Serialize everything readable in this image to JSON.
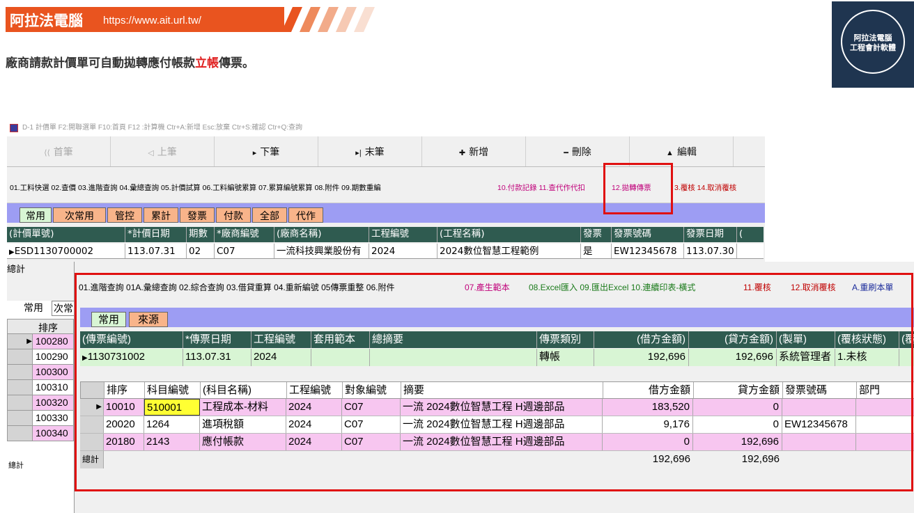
{
  "banner": {
    "brand": "阿拉法電腦",
    "url": "https://www.ait.url.tw/"
  },
  "headline": {
    "before": "廠商請款計價單可自動拋轉應付帳款",
    "highlight": "立帳",
    "after": "傳票。"
  },
  "logo": {
    "line1": "阿拉法電腦",
    "line2": "工程會計軟體"
  },
  "window1": {
    "title": "D-1 計價單   F2:開聯選單  F10:首頁   F12 :計算機  Ctr+A:新增  Esc:放棄  Ctr+S:確認  Ctr+Q:查詢",
    "toolbar": [
      {
        "icon": "⟨⟨",
        "label": "首筆",
        "dim": true
      },
      {
        "icon": "◁",
        "label": "上筆",
        "dim": true
      },
      {
        "icon": "▸",
        "label": "下筆",
        "dim": false
      },
      {
        "icon": "▸|",
        "label": "末筆",
        "dim": false
      },
      {
        "icon": "✚",
        "label": "新增",
        "dim": false
      },
      {
        "icon": "━",
        "label": "刪除",
        "dim": false
      },
      {
        "icon": "▲",
        "label": "編輯",
        "dim": false
      }
    ],
    "functions": {
      "group1": "01.工料快選 02.查價 03.進階查詢  04.彙總查詢  05.計價試算  06.工料編號累算 07.累算編號累算  08.附件  09.期數重編",
      "group2": "10.付款記錄  11.查代作代扣",
      "highlight": "12.拋轉傳票",
      "group3": "3.覆核  14.取消覆核"
    },
    "tabs": [
      "常用",
      "次常用",
      "管控",
      "累計",
      "發票",
      "付款",
      "全部",
      "代作"
    ],
    "columns": [
      "(計價單號)",
      "*計價日期",
      "期數",
      "*廠商編號",
      "(廠商名稱)",
      "工程編號",
      "(工程名稱)",
      "發票",
      "發票號碼",
      "發票日期",
      "("
    ],
    "row": [
      "ESD1130700002",
      "113.07.31",
      "02",
      "C07",
      "一流科技興業股份有",
      "2024",
      "2024數位智慧工程範例",
      "是",
      "EW12345678",
      "113.07.30",
      ""
    ],
    "total_label": "總計"
  },
  "left_panel": {
    "tabs": [
      "常用",
      "次常"
    ],
    "header": "排序",
    "rows": [
      "100280",
      "100290",
      "100300",
      "100310",
      "100320",
      "100330",
      "100340"
    ],
    "total_label": "總計"
  },
  "window2": {
    "functions": {
      "group1": "01.進階查詢 01A.彙總查詢  02.綜合查詢  03.借貸重算  04.重新編號  05傳票重整  06.附件",
      "g2": "07.產生範本",
      "g3": "08.Excel匯入  09.匯出Excel  10.連續印表-橫式",
      "g4": "11.覆核",
      "g5": "12.取消覆核",
      "g6": "A.重刷本單"
    },
    "tabs": [
      "常用",
      "來源"
    ],
    "columns": [
      "(傳票編號)",
      "*傳票日期",
      "工程編號",
      "套用範本",
      "總摘要",
      "傳票類別",
      "(借方金額)",
      "(貸方金額)",
      "(製單)",
      "(覆核狀態)",
      "(覆"
    ],
    "row": [
      "1130731002",
      "113.07.31",
      "2024",
      "",
      "",
      "轉帳",
      "192,696",
      "192,696",
      "系統管理者",
      "1.未核",
      ""
    ],
    "lines": {
      "columns": [
        "排序",
        "科目編號",
        "(科目名稱)",
        "工程編號",
        "對象編號",
        "摘要",
        "借方金額",
        "貸方金額",
        "發票號碼",
        "部門"
      ],
      "rows": [
        [
          "10010",
          "510001",
          "工程成本-材料",
          "2024",
          "C07",
          "一流 2024數位智慧工程 H週邊部品",
          "183,520",
          "0",
          "",
          ""
        ],
        [
          "20020",
          "1264",
          "進項稅額",
          "2024",
          "C07",
          "一流 2024數位智慧工程 H週邊部品",
          "9,176",
          "0",
          "EW12345678",
          ""
        ],
        [
          "20180",
          "2143",
          "應付帳款",
          "2024",
          "C07",
          "一流 2024數位智慧工程 H週邊部品",
          "0",
          "192,696",
          "",
          ""
        ]
      ],
      "total_label": "總計",
      "total_debit": "192,696",
      "total_credit": "192,696"
    }
  }
}
